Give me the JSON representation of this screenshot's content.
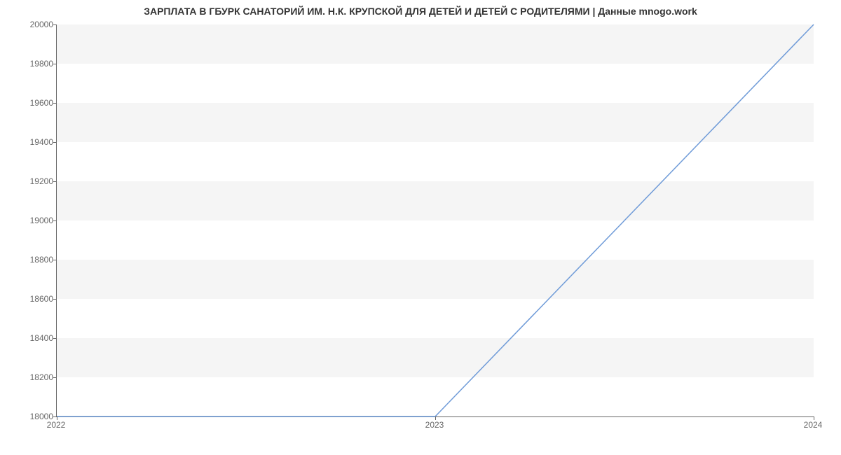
{
  "chart_data": {
    "type": "line",
    "title": "ЗАРПЛАТА В ГБУРК САНАТОРИЙ ИМ. Н.К. КРУПСКОЙ ДЛЯ ДЕТЕЙ И ДЕТЕЙ С РОДИТЕЛЯМИ | Данные mnogo.work",
    "x": [
      2022,
      2023,
      2024
    ],
    "series": [
      {
        "name": "salary",
        "values": [
          18000,
          18000,
          20000
        ],
        "color": "#6f9bd8"
      }
    ],
    "xlabel": "",
    "ylabel": "",
    "xlim": [
      2022,
      2024
    ],
    "ylim": [
      18000,
      20000
    ],
    "x_ticks": [
      2022,
      2023,
      2024
    ],
    "y_ticks": [
      18000,
      18200,
      18400,
      18600,
      18800,
      19000,
      19200,
      19400,
      19600,
      19800,
      20000
    ]
  }
}
